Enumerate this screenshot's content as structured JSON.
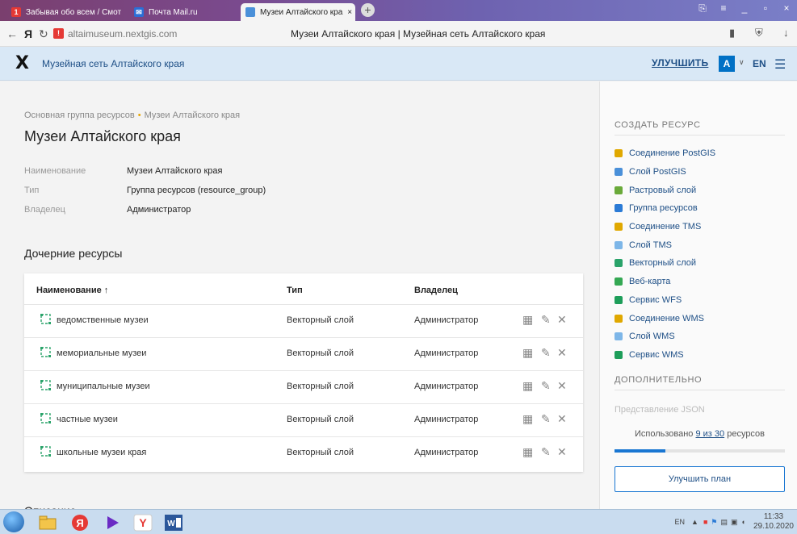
{
  "browser": {
    "tabs": [
      {
        "label": "Забывая обо всем / Смот",
        "badge": "1"
      },
      {
        "label": "Почта Mail.ru"
      },
      {
        "label": "Музеи Алтайского кра",
        "close": "×"
      }
    ],
    "url": "altaimuseum.nextgis.com",
    "page_title": "Музеи Алтайского края | Музейная сеть Алтайского края"
  },
  "header": {
    "logo": "X",
    "app_title": "Музейная сеть Алтайского края",
    "upgrade": "УЛУЧШИТЬ",
    "avatar": "A",
    "lang": "EN"
  },
  "main": {
    "breadcrumb": {
      "parent": "Основная группа ресурсов",
      "sep": "•",
      "current": "Музеи Алтайского края"
    },
    "title": "Музеи Алтайского края",
    "properties": [
      {
        "key": "Наименование",
        "value": "Музеи Алтайского края"
      },
      {
        "key": "Тип",
        "value": "Группа ресурсов (resource_group)"
      },
      {
        "key": "Владелец",
        "value": "Администратор"
      }
    ],
    "children_heading": "Дочерние ресурсы",
    "table": {
      "headers": {
        "name": "Наименование ↑",
        "type": "Тип",
        "owner": "Владелец"
      },
      "rows": [
        {
          "name": "ведомственные музеи",
          "type": "Векторный слой",
          "owner": "Администратор"
        },
        {
          "name": "мемориальные музеи",
          "type": "Векторный слой",
          "owner": "Администратор"
        },
        {
          "name": "муниципальные музеи",
          "type": "Векторный слой",
          "owner": "Администратор"
        },
        {
          "name": "частные музеи",
          "type": "Векторный слой",
          "owner": "Администратор"
        },
        {
          "name": "школьные музеи края",
          "type": "Векторный слой",
          "owner": "Администратор"
        }
      ]
    },
    "description_heading": "Описание"
  },
  "sidebar": {
    "create_heading": "СОЗДАТЬ РЕСУРС",
    "create_items": [
      {
        "label": "Соединение PostGIS",
        "color": "#e0a800"
      },
      {
        "label": "Слой PostGIS",
        "color": "#4a90d9"
      },
      {
        "label": "Растровый слой",
        "color": "#6aaa3a"
      },
      {
        "label": "Группа ресурсов",
        "color": "#2b7bd6"
      },
      {
        "label": "Соединение TMS",
        "color": "#e0a800"
      },
      {
        "label": "Слой TMS",
        "color": "#7db6e8"
      },
      {
        "label": "Векторный слой",
        "color": "#2aa36a"
      },
      {
        "label": "Веб-карта",
        "color": "#34a853"
      },
      {
        "label": "Сервис WFS",
        "color": "#1e9e5a"
      },
      {
        "label": "Соединение WMS",
        "color": "#e0a800"
      },
      {
        "label": "Слой WMS",
        "color": "#7db6e8"
      },
      {
        "label": "Сервис WMS",
        "color": "#1e9e5a"
      }
    ],
    "extra_heading": "ДОПОЛНИТЕЛЬНО",
    "json_link": "Представление JSON",
    "usage_prefix": "Использовано",
    "usage_link": "9 из 30",
    "usage_suffix": "ресурсов",
    "usage_fraction": 0.3,
    "upgrade_plan": "Улучшить план"
  },
  "taskbar": {
    "lang": "EN",
    "time": "11:33",
    "date": "29.10.2020"
  }
}
